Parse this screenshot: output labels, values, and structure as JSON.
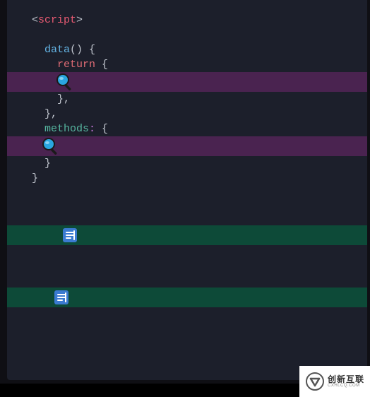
{
  "code": {
    "lt": "<",
    "gt": ">",
    "script_tag": "script",
    "data_fn": "data",
    "data_parens": "()",
    "brace_open": " {",
    "return_kw": "return",
    "return_brace": " {",
    "close_brace_comma_1": "},",
    "close_brace_comma_2": "},",
    "methods_key": "methods",
    "methods_colon": ":",
    "methods_brace": " {",
    "close_brace_1": "}",
    "close_brace_2": "}"
  },
  "icons": {
    "magnifier": "🔍",
    "document": "📃"
  },
  "logo": {
    "cn": "创新互联",
    "en": "CXHLCQ.COM"
  }
}
